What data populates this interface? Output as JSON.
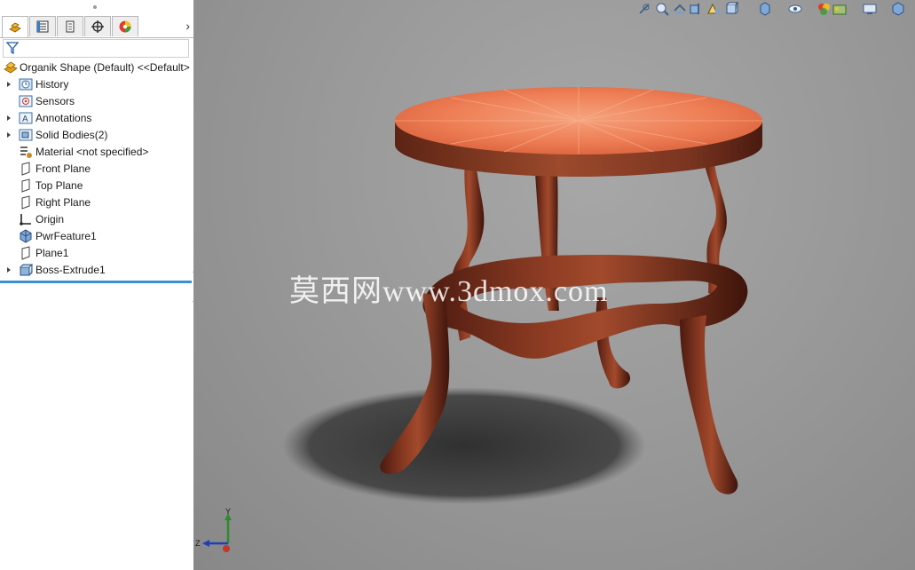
{
  "feature_tree": {
    "root": "Organik Shape (Default) <<Default>",
    "items": [
      {
        "label": "History",
        "icon": "history-folder-icon",
        "expandable": true
      },
      {
        "label": "Sensors",
        "icon": "sensors-icon",
        "expandable": false
      },
      {
        "label": "Annotations",
        "icon": "annotations-icon",
        "expandable": true
      },
      {
        "label": "Solid Bodies(2)",
        "icon": "solid-bodies-icon",
        "expandable": true
      },
      {
        "label": "Material <not specified>",
        "icon": "material-icon",
        "expandable": false
      },
      {
        "label": "Front Plane",
        "icon": "plane-icon",
        "expandable": false
      },
      {
        "label": "Top Plane",
        "icon": "plane-icon",
        "expandable": false
      },
      {
        "label": "Right Plane",
        "icon": "plane-icon",
        "expandable": false
      },
      {
        "label": "Origin",
        "icon": "origin-icon",
        "expandable": false
      },
      {
        "label": "PwrFeature1",
        "icon": "power-feature-icon",
        "expandable": false
      },
      {
        "label": "Plane1",
        "icon": "plane-icon",
        "expandable": false
      },
      {
        "label": "Boss-Extrude1",
        "icon": "boss-extrude-icon",
        "expandable": true
      }
    ]
  },
  "tabs": [
    "feature-manager",
    "property-manager",
    "configuration-manager",
    "dimxpert-manager",
    "display-manager"
  ],
  "viewport": {
    "watermark": "莫西网www.3dmox.com",
    "triad": {
      "x": "",
      "y": "Y",
      "z": "Z"
    }
  },
  "colors": {
    "rollback_bar": "#3d8fd1",
    "accent": "#3d8fd1"
  }
}
